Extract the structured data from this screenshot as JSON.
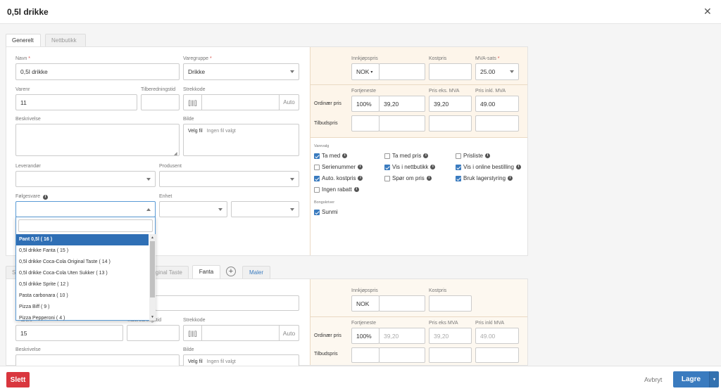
{
  "window": {
    "title": "0,5l drikke"
  },
  "tabs": [
    {
      "label": "Generelt"
    },
    {
      "label": "Nettbutikk"
    }
  ],
  "form": {
    "navn_label": "Navn",
    "navn_value": "0,5l drikke",
    "varegruppe_label": "Varegruppe",
    "varegruppe_value": "Drikke",
    "varenr_label": "Varenr",
    "varenr_value": "11",
    "tilberedningstid_label": "Tilberedningstid",
    "strekkode_label": "Strekkode",
    "auto_label": "Auto",
    "beskrivelse_label": "Beskrivelse",
    "bilde_label": "Bilde",
    "velg_fil": "Velg fil",
    "ingen_fil": "Ingen fil valgt",
    "leverandor_label": "Leverandør",
    "produsent_label": "Produsent",
    "folgesvare_label": "Følgesvare",
    "enhet_label": "Enhet"
  },
  "pricing": {
    "innkjopspris_label": "Innkjøpspris",
    "kostpris_label": "Kostpris",
    "mva_label": "MVA-sats",
    "currency": "NOK",
    "mva_value": "25.00",
    "fortjeneste_label": "Fortjeneste",
    "pris_eks_label": "Pris eks. MVA",
    "pris_inkl_label": "Pris inkl. MVA",
    "ordinaer_label": "Ordinær pris",
    "tilbud_label": "Tilbudspris",
    "fortjeneste_value": "100%",
    "value_a": "39,20",
    "pris_eks_value": "39,20",
    "pris_inkl_value": "49.00"
  },
  "varevalg": {
    "heading": "Varevalg",
    "items": [
      {
        "label": "Ta med",
        "checked": true
      },
      {
        "label": "Ta med pris",
        "checked": false
      },
      {
        "label": "Prisliste",
        "checked": false
      },
      {
        "label": "Serienummer",
        "checked": false
      },
      {
        "label": "Vis i nettbutikk",
        "checked": true
      },
      {
        "label": "Vis i online bestilling",
        "checked": true
      },
      {
        "label": "Auto. kostpris",
        "checked": true
      },
      {
        "label": "Spør om pris",
        "checked": false
      },
      {
        "label": "Bruk lagerstyring",
        "checked": true
      },
      {
        "label": "Ingen rabatt",
        "checked": false
      }
    ]
  },
  "bongskriver": {
    "heading": "Bongskriver",
    "item": "Sunmi",
    "checked": true
  },
  "dropdown": {
    "options": [
      "Pant 0,5l ( 16 )",
      "0,5l drikke Fanta ( 15 )",
      "0,5l drikke Coca-Cola Original Taste ( 14 )",
      "0,5l drikke Coca-Cola Uten Sukker ( 13 )",
      "0,5l drikke Sprite ( 12 )",
      "Pasta carbonara ( 10 )",
      "Pizza Biff ( 9 )",
      "Pizza Pepperoni ( 4 )"
    ]
  },
  "variant_tabs": {
    "first_partial": "S",
    "original_partial": "iginal Taste",
    "fanta": "Fanta",
    "add": "+",
    "maler": "Maler"
  },
  "variant": {
    "varenr_partial": "arenr",
    "varenr_value": "15",
    "tilb_partial": "Tilberedningstid",
    "strekkode_label": "Strekkode",
    "auto_label": "Auto",
    "beskrivelse_label": "Beskrivelse",
    "bilde_label": "Bilde",
    "velg_fil": "Velg fil",
    "ingen_fil": "Ingen fil valgt",
    "innkjopspris_label": "Innkjøpspris",
    "kostpris_label": "Kostpris",
    "currency": "NOK",
    "fortjeneste_label": "Fortjeneste",
    "pris_eks_label": "Pris eks MVA",
    "pris_inkl_label": "Pris inkl MVA",
    "ordinaer_label": "Ordinær pris",
    "tilbud_label": "Tilbudspris",
    "fortjeneste_value": "100%",
    "value_a": "39,20",
    "pris_eks_value": "39,20",
    "pris_inkl_value": "49.00"
  },
  "footer": {
    "delete": "Slett",
    "cancel": "Avbryt",
    "save": "Lagre"
  },
  "colors": {
    "primary": "#3a7bbf",
    "danger": "#d9363e",
    "price_bg": "#fdf8f0"
  }
}
